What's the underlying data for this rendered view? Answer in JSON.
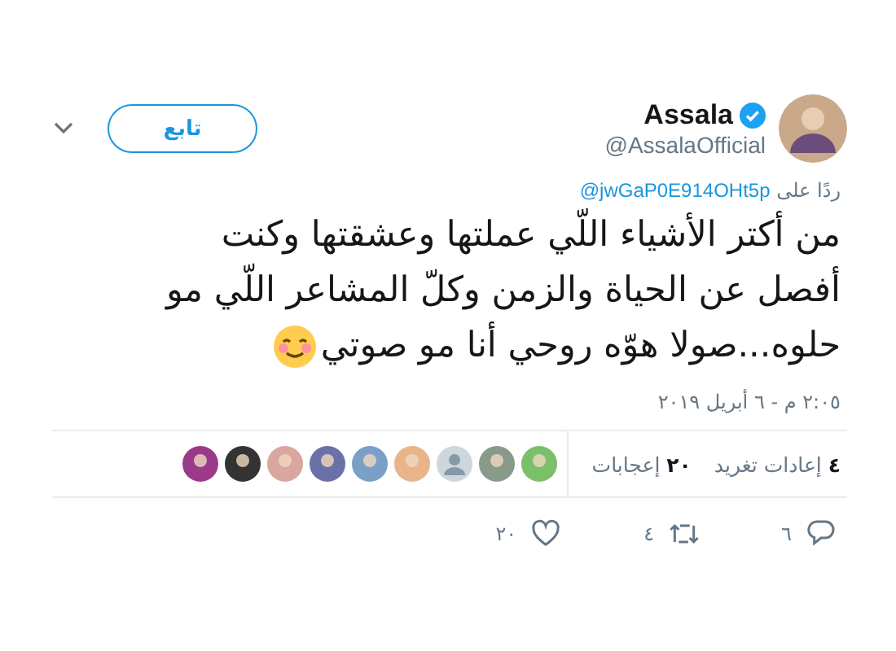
{
  "author": {
    "name": "Assala",
    "verified": true,
    "handle": "@AssalaOfficial"
  },
  "follow_button": "تابع",
  "reply_to": {
    "prefix": "ردًا على",
    "handle": "@jwGaP0E914OHt5p"
  },
  "text_lines": [
    "من أكتر الأشياء اللّي عملتها وعشقتها وكنت",
    "أفصل عن الحياة والزمن وكلّ المشاعر اللّي مو",
    "حلوه...صولا هوّه روحي أنا مو صوتي"
  ],
  "timestamp": "٢:٠٥ م - ٦ أبريل ٢٠١٩",
  "stats": [
    "**٤** إعادات تغريد",
    "**٢٠** إعجابات"
  ],
  "likers": [
    {
      "kind": "photo"
    },
    {
      "kind": "photo"
    },
    {
      "kind": "default"
    },
    {
      "kind": "photo"
    },
    {
      "kind": "photo"
    },
    {
      "kind": "photo"
    },
    {
      "kind": "photo"
    },
    {
      "kind": "photo"
    },
    {
      "kind": "photo"
    }
  ],
  "actions": [
    {
      "kind": "reply",
      "count": "٦"
    },
    {
      "kind": "retweet",
      "count": "٤"
    },
    {
      "kind": "like",
      "count": "٢٠"
    }
  ]
}
